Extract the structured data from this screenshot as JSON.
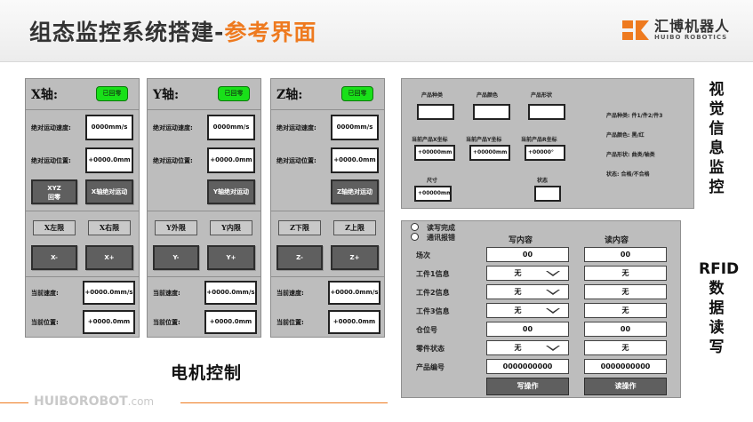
{
  "header": {
    "title_main": "组态监控系统搭建-",
    "title_accent": "参考界面",
    "logo_cn": "汇博机器人",
    "logo_en": "HUIBO ROBOTICS",
    "accent_color": "#ee7a1f"
  },
  "motor_control": {
    "caption": "电机控制",
    "labels": {
      "abs_speed": "绝对运动速度:",
      "abs_position": "绝对运动位置:",
      "current_speed": "当前速度:",
      "current_position": "当前位置:"
    },
    "axes": [
      {
        "title": "X轴:",
        "zero_badge": "已回零",
        "abs_speed_value": "0000mm/s",
        "abs_position_value": "+0000.0mm",
        "xyz_home_label": "XYZ\n回零",
        "abs_move_label": "X轴绝对运动",
        "limit_left": "X左限",
        "limit_right": "X右限",
        "jog_minus": "X-",
        "jog_plus": "X+",
        "current_speed_value": "+0000.0mm/s",
        "current_position_value": "+0000.0mm"
      },
      {
        "title": "Y轴:",
        "zero_badge": "已回零",
        "abs_speed_value": "0000mm/s",
        "abs_position_value": "+0000.0mm",
        "abs_move_label": "Y轴绝对运动",
        "limit_left": "Y外限",
        "limit_right": "Y内限",
        "jog_minus": "Y-",
        "jog_plus": "Y+",
        "current_speed_value": "+0000.0mm/s",
        "current_position_value": "+0000.0mm"
      },
      {
        "title": "Z轴:",
        "zero_badge": "已回零",
        "abs_speed_value": "0000mm/s",
        "abs_position_value": "+0000.0mm",
        "abs_move_label": "Z轴绝对运动",
        "limit_left": "Z下限",
        "limit_right": "Z上限",
        "jog_minus": "Z-",
        "jog_plus": "Z+",
        "current_speed_value": "+0000.0mm/s",
        "current_position_value": "+0000.0mm"
      }
    ]
  },
  "vision": {
    "caption": "视觉信息监控",
    "product_type_label": "产品种类",
    "product_color_label": "产品颜色",
    "product_shape_label": "产品形状",
    "pos_x_label": "当前产品X坐标",
    "pos_y_label": "当前产品Y坐标",
    "pos_r_label": "当前产品R坐标",
    "pos_x_value": "+00000mm",
    "pos_y_value": "+00000mm",
    "pos_r_value": "+00000°",
    "size_label": "尺寸",
    "size_value": "+00000mm",
    "state_label": "状态",
    "legend": [
      "产品种类: 件1/件2/件3",
      "产品颜色: 黑/红",
      "产品形状: 曲类/轴类",
      "状态: 合格/不合格"
    ]
  },
  "rfid": {
    "caption": "RFID数据读写",
    "radio_write_done": "读写完成",
    "radio_comm_error": "通讯报错",
    "write_header": "写内容",
    "read_header": "读内容",
    "rows": [
      {
        "label": "场次",
        "write": "00",
        "read": "00",
        "dropdown": false
      },
      {
        "label": "工件1信息",
        "write": "无",
        "read": "无",
        "dropdown": true
      },
      {
        "label": "工件2信息",
        "write": "无",
        "read": "无",
        "dropdown": true
      },
      {
        "label": "工件3信息",
        "write": "无",
        "read": "无",
        "dropdown": true
      },
      {
        "label": "仓位号",
        "write": "00",
        "read": "00",
        "dropdown": false
      },
      {
        "label": "零件状态",
        "write": "无",
        "read": "无",
        "dropdown": true
      },
      {
        "label": "产品编号",
        "write": "0000000000",
        "read": "0000000000",
        "dropdown": false
      }
    ],
    "write_button": "写操作",
    "read_button": "读操作"
  },
  "footer": {
    "brand": "HUIBOROBOT",
    "domain_suffix": ".com"
  }
}
